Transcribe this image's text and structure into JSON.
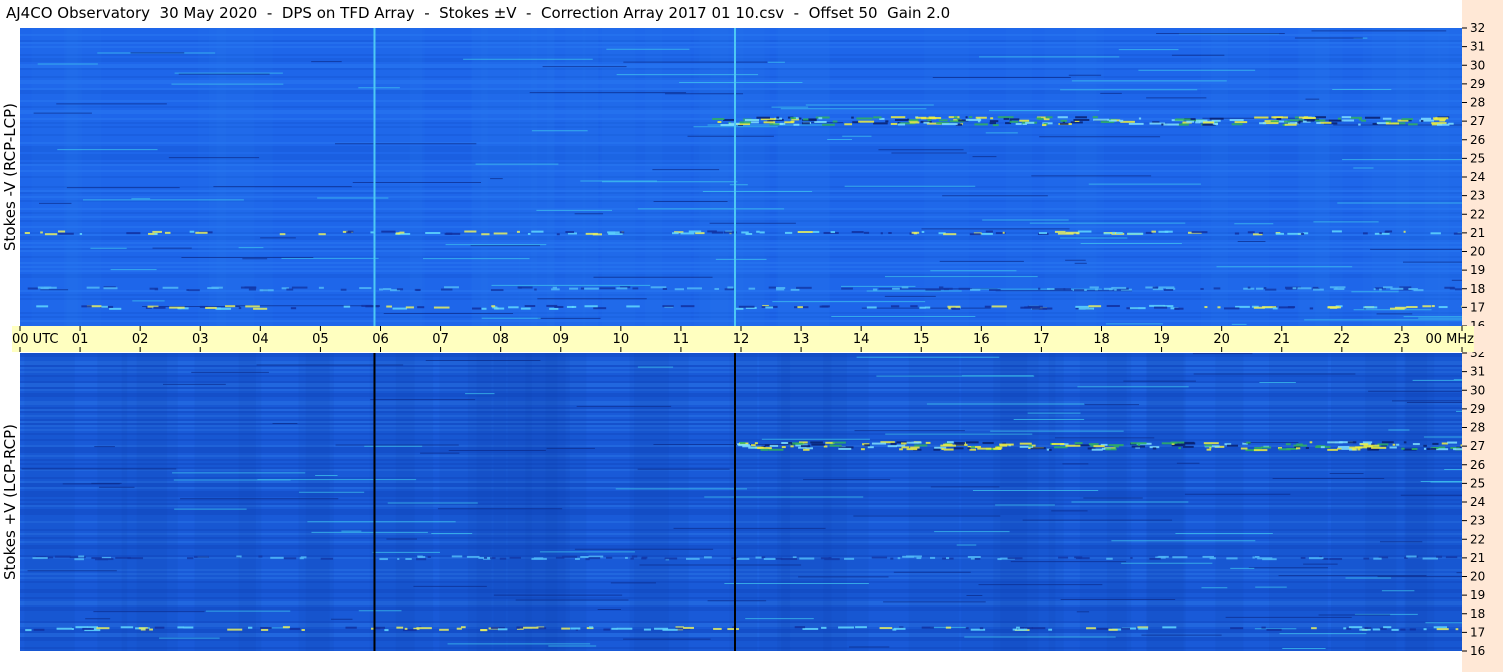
{
  "header": {
    "title": "AJ4CO Observatory  30 May 2020  -  DPS on TFD Array  -  Stokes ±V  -  Correction Array 2017 01 10.csv  -  Offset 50  Gain 2.0"
  },
  "panels": {
    "top": {
      "ylabel": "Stokes -V (RCP-LCP)"
    },
    "bottom": {
      "ylabel": "Stokes +V (LCP-RCP)"
    }
  },
  "colors": {
    "background_blue": "#1e63e6",
    "time_bar": "#ffffc0",
    "frequency_bar": "#ffe8d6"
  },
  "chart_data": {
    "type": "heatmap",
    "x_axis": {
      "ticks": [
        "00",
        "01",
        "02",
        "03",
        "04",
        "05",
        "06",
        "07",
        "08",
        "09",
        "10",
        "11",
        "12",
        "13",
        "14",
        "15",
        "16",
        "17",
        "18",
        "19",
        "20",
        "21",
        "22",
        "23",
        "00"
      ],
      "start_label_suffix": "UTC",
      "end_label_suffix": "MHz",
      "range_hours": [
        0,
        24
      ]
    },
    "y_axis": {
      "ticks": [
        32,
        31,
        30,
        29,
        28,
        27,
        26,
        25,
        24,
        23,
        22,
        21,
        20,
        19,
        18,
        17,
        16
      ],
      "range_mhz": [
        16,
        32
      ]
    },
    "vertical_markers_utc": [
      5.9,
      11.9
    ],
    "strong_features": [
      {
        "panel": "top",
        "freq_mhz": 27.0,
        "utc_start": 11.5,
        "utc_end": 24,
        "intensity": "strong"
      },
      {
        "panel": "top",
        "freq_mhz": 21.0,
        "utc_start": 0,
        "utc_end": 24,
        "intensity": "medium"
      },
      {
        "panel": "top",
        "freq_mhz": 17.0,
        "utc_start": 0,
        "utc_end": 24,
        "intensity": "medium"
      },
      {
        "panel": "top",
        "freq_mhz": 18.0,
        "utc_start": 0,
        "utc_end": 24,
        "intensity": "low"
      },
      {
        "panel": "bottom",
        "freq_mhz": 27.0,
        "utc_start": 11.9,
        "utc_end": 24,
        "intensity": "strong"
      },
      {
        "panel": "bottom",
        "freq_mhz": 21.0,
        "utc_start": 0,
        "utc_end": 24,
        "intensity": "low"
      },
      {
        "panel": "bottom",
        "freq_mhz": 17.2,
        "utc_start": 0,
        "utc_end": 24,
        "intensity": "medium"
      }
    ]
  }
}
